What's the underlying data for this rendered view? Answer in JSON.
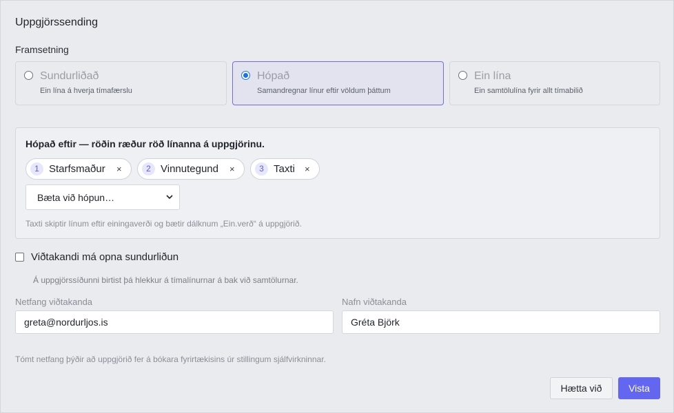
{
  "title": "Uppgjörssending",
  "presentation": {
    "label": "Framsetning",
    "options": [
      {
        "title": "Sundurliðað",
        "desc": "Ein lína á hverja tímafærslu",
        "selected": false
      },
      {
        "title": "Hópað",
        "desc": "Samandregnar línur eftir völdum þáttum",
        "selected": true
      },
      {
        "title": "Ein lína",
        "desc": "Ein samtölulína fyrir allt tímabilið",
        "selected": false
      }
    ]
  },
  "grouping": {
    "heading": "Hópað eftir — röðin ræður röð línanna á uppgjörinu.",
    "chips": [
      {
        "num": "1",
        "label": "Starfsmaður",
        "remove": "×"
      },
      {
        "num": "2",
        "label": "Vinnutegund",
        "remove": "×"
      },
      {
        "num": "3",
        "label": "Taxti",
        "remove": "×"
      }
    ],
    "add_select": "Bæta við hópun…",
    "note": "Taxti skiptir línum eftir einingaverði og bætir dálknum „Ein.verð“ á uppgjörið."
  },
  "drilldown": {
    "label": "Viðtakandi má opna sundurliðun",
    "checked": false,
    "note": "Á uppgjörssíðunni birtist þá hlekkur á tímalínurnar á bak við samtölurnar."
  },
  "recipient": {
    "email_label": "Netfang viðtakanda",
    "email_value": "greta@nordurljos.is",
    "name_label": "Nafn viðtakanda",
    "name_value": "Gréta Björk"
  },
  "bottom_note": "Tómt netfang þýðir að uppgjörið fer á bókara fyrirtækisins úr stillingum sjálfvirkninnar.",
  "buttons": {
    "cancel": "Hætta við",
    "save": "Vista"
  },
  "colors": {
    "accent": "#6366f1",
    "radio_selected": "#1a73e8",
    "background": "#e9ebef"
  }
}
